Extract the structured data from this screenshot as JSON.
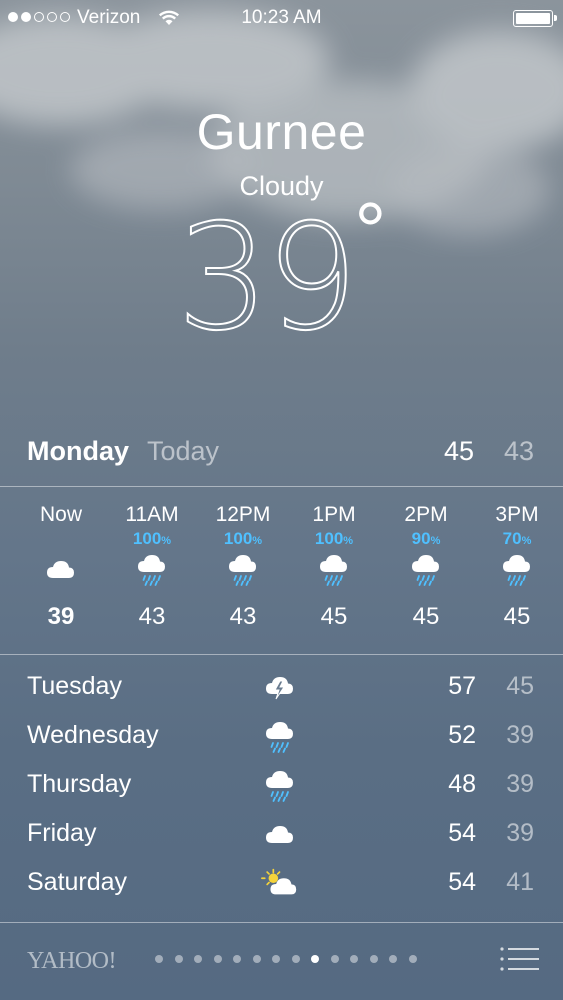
{
  "status": {
    "carrier": "Verizon",
    "time": "10:23 AM",
    "signal_bars": 2,
    "signal_total": 5
  },
  "location": {
    "city": "Gurnee",
    "condition": "Cloudy",
    "temperature": "39",
    "degree": "°"
  },
  "today": {
    "day": "Monday",
    "label": "Today",
    "high": "45",
    "low": "43"
  },
  "hourly": [
    {
      "time": "Now",
      "precip": "",
      "icon": "cloud-icon",
      "temp": "39"
    },
    {
      "time": "11AM",
      "precip": "100",
      "icon": "rain-cloud-icon",
      "temp": "43"
    },
    {
      "time": "12PM",
      "precip": "100",
      "icon": "rain-cloud-icon",
      "temp": "43"
    },
    {
      "time": "1PM",
      "precip": "100",
      "icon": "rain-cloud-icon",
      "temp": "45"
    },
    {
      "time": "2PM",
      "precip": "90",
      "icon": "rain-cloud-icon",
      "temp": "45"
    },
    {
      "time": "3PM",
      "precip": "70",
      "icon": "rain-cloud-icon",
      "temp": "45"
    }
  ],
  "percent_sign": "%",
  "daily": [
    {
      "day": "Tuesday",
      "icon": "thunderstorm-icon",
      "high": "57",
      "low": "45"
    },
    {
      "day": "Wednesday",
      "icon": "rain-cloud-icon",
      "high": "52",
      "low": "39"
    },
    {
      "day": "Thursday",
      "icon": "rain-cloud-icon",
      "high": "48",
      "low": "39"
    },
    {
      "day": "Friday",
      "icon": "cloud-icon",
      "high": "54",
      "low": "39"
    },
    {
      "day": "Saturday",
      "icon": "partly-sunny-icon",
      "high": "54",
      "low": "41"
    }
  ],
  "footer": {
    "brand": "YAHOO!",
    "page_count": 14,
    "active_page": 9
  },
  "colors": {
    "precip": "#4fc0ff",
    "sun": "#f5d33a"
  }
}
